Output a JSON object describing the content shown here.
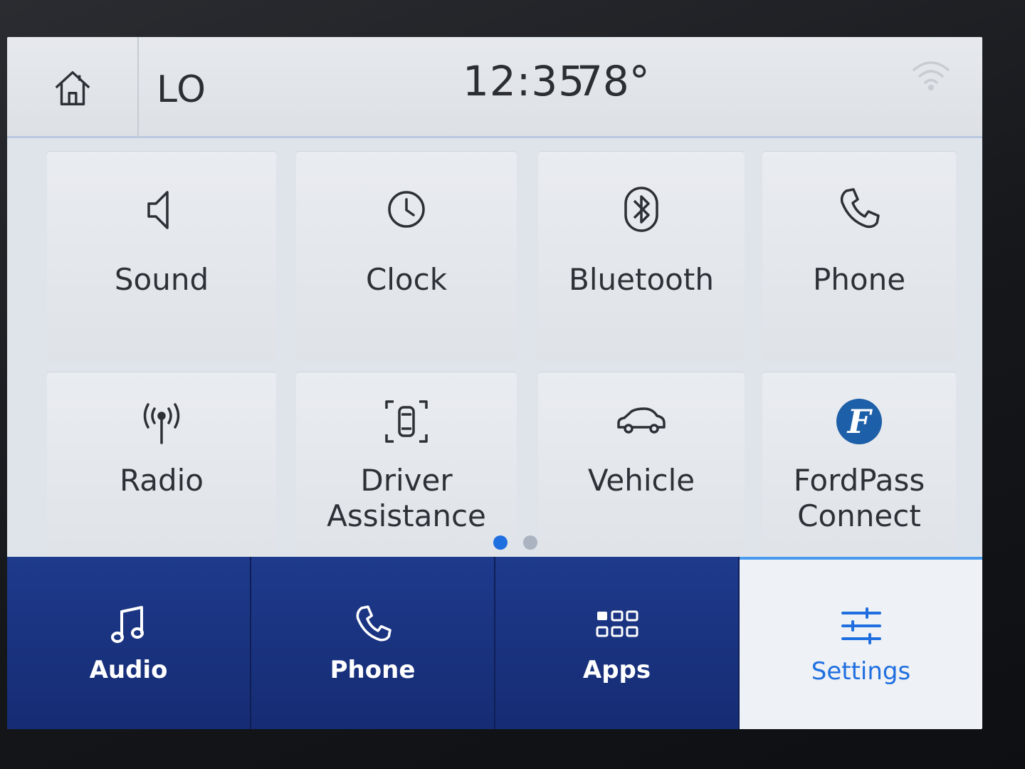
{
  "status": {
    "climate": "LO",
    "time": "12:35",
    "temperature": "78°"
  },
  "tiles": [
    {
      "label": "Sound",
      "icon": "speaker-icon"
    },
    {
      "label": "Clock",
      "icon": "clock-icon"
    },
    {
      "label": "Bluetooth",
      "icon": "bluetooth-icon"
    },
    {
      "label": "Phone",
      "icon": "phone-icon"
    },
    {
      "label": "Radio",
      "icon": "radio-antenna-icon"
    },
    {
      "label": "Driver Assistance",
      "icon": "driver-assist-icon"
    },
    {
      "label": "Vehicle",
      "icon": "car-icon"
    },
    {
      "label": "FordPass Connect",
      "icon": "fordpass-logo-icon"
    }
  ],
  "pages": {
    "current": 1,
    "total": 2
  },
  "nav": [
    {
      "label": "Audio",
      "icon": "music-note-icon"
    },
    {
      "label": "Phone",
      "icon": "phone-icon"
    },
    {
      "label": "Apps",
      "icon": "apps-grid-icon"
    },
    {
      "label": "Settings",
      "icon": "settings-sliders-icon"
    }
  ],
  "colors": {
    "accent": "#1f6fe0",
    "navbar": "#1e3a8c",
    "background": "#dfe4ea"
  }
}
